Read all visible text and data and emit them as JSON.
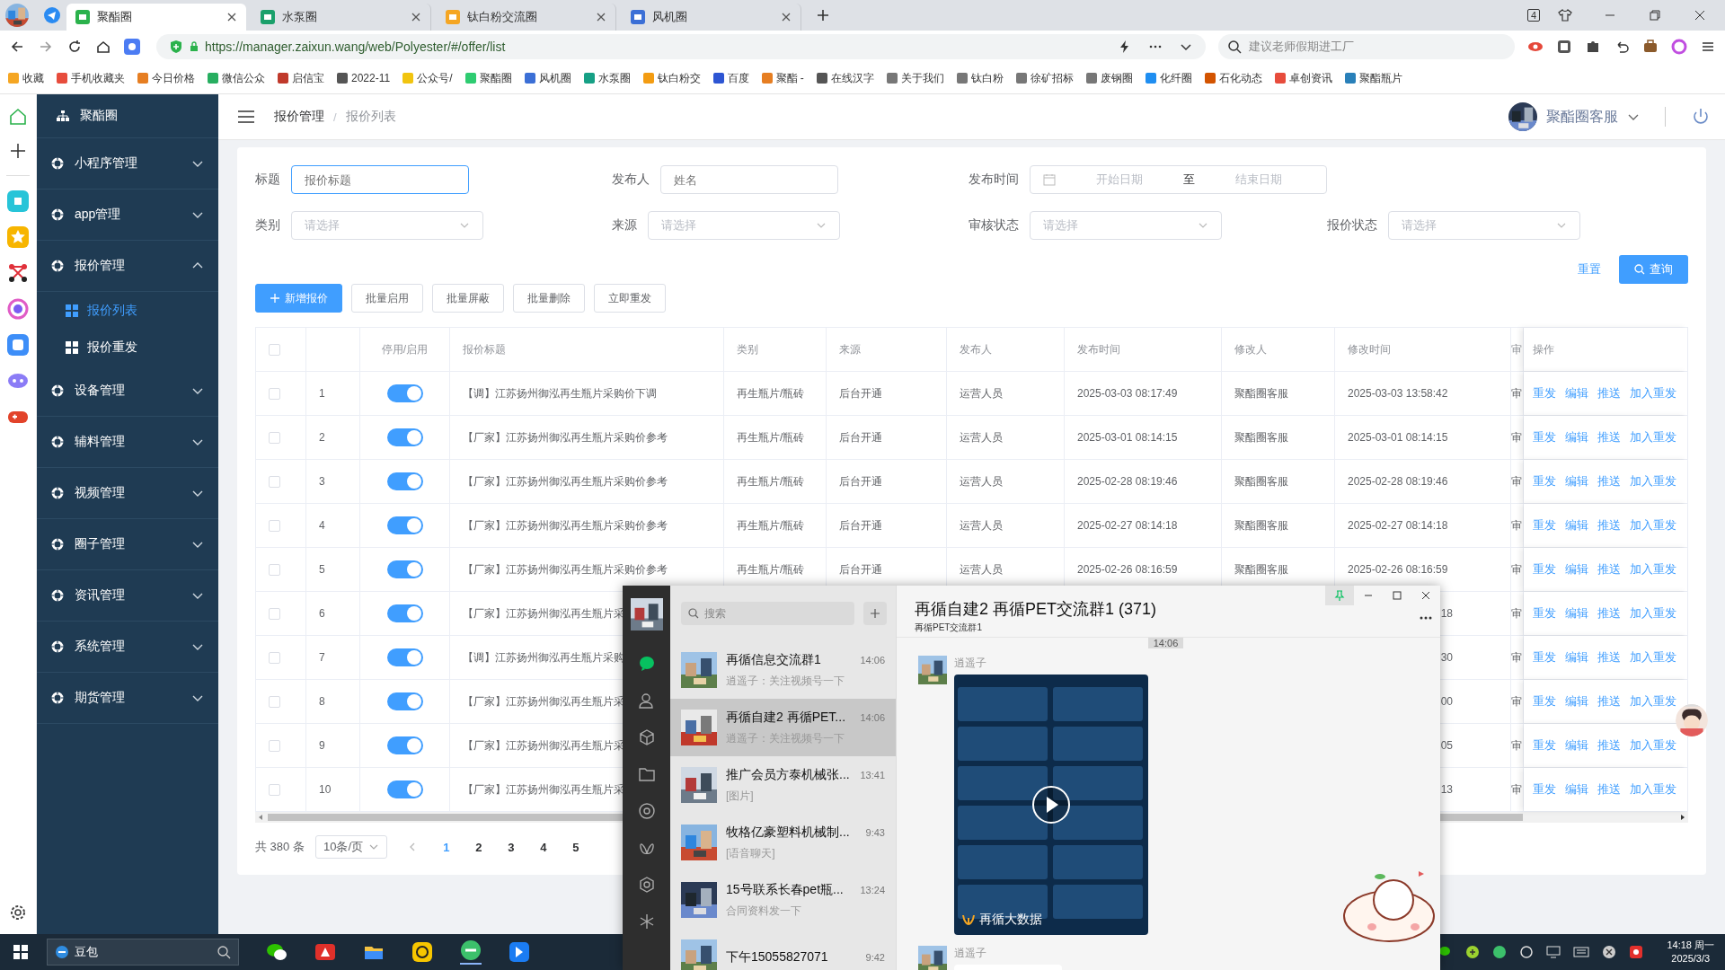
{
  "browser": {
    "tabs": [
      {
        "title": "聚酯圈",
        "selected": true
      },
      {
        "title": "水泵圈",
        "selected": false
      },
      {
        "title": "钛白粉交流圈",
        "selected": false
      },
      {
        "title": "风机圈",
        "selected": false
      }
    ],
    "window_count": "4",
    "url": "https://manager.zaixun.wang/web/Polyester/#/offer/list",
    "search": {
      "placeholder": "建议老师假期进工厂"
    },
    "bookmarks": [
      "收藏",
      "手机收藏夹",
      "今日价格",
      "微信公众",
      "启信宝",
      "2022-11",
      "公众号/",
      "聚酯圈",
      "风机圈",
      "水泵圈",
      "钛白粉交",
      "百度",
      "聚酯 -",
      "在线汉字",
      "关于我们",
      "钛白粉",
      "徐矿招标",
      "废钢圈",
      "化纤圈",
      "石化动态",
      "卓创资讯",
      "聚酯瓶片"
    ]
  },
  "sidebar": {
    "brand": "聚酯圈",
    "items": [
      {
        "label": "小程序管理",
        "expanded": false
      },
      {
        "label": "app管理",
        "expanded": false
      },
      {
        "label": "报价管理",
        "expanded": true,
        "children": [
          {
            "label": "报价列表",
            "selected": true
          },
          {
            "label": "报价重发",
            "selected": false
          }
        ]
      },
      {
        "label": "设备管理",
        "expanded": false
      },
      {
        "label": "辅料管理",
        "expanded": false
      },
      {
        "label": "视频管理",
        "expanded": false
      },
      {
        "label": "圈子管理",
        "expanded": false
      },
      {
        "label": "资讯管理",
        "expanded": false
      },
      {
        "label": "系统管理",
        "expanded": false
      },
      {
        "label": "期货管理",
        "expanded": false
      }
    ]
  },
  "header": {
    "breadcrumb": [
      "报价管理",
      "报价列表"
    ],
    "separator": "/",
    "user": "聚酯圈客服"
  },
  "filter_rows": [
    [
      {
        "label": "标题",
        "kind": "input",
        "placeholder": "报价标题",
        "focused": true
      },
      {
        "label": "发布人",
        "kind": "input",
        "placeholder": "姓名",
        "focused": false
      },
      {
        "label": "发布时间",
        "kind": "daterange",
        "start_placeholder": "开始日期",
        "separator": "至",
        "end_placeholder": "结束日期"
      }
    ],
    [
      {
        "label": "类别",
        "kind": "select",
        "placeholder": "请选择"
      },
      {
        "label": "来源",
        "kind": "select",
        "placeholder": "请选择"
      },
      {
        "label": "审核状态",
        "kind": "select",
        "placeholder": "请选择"
      },
      {
        "label": "报价状态",
        "kind": "select",
        "placeholder": "请选择"
      }
    ]
  ],
  "search_buttons": {
    "reset": "重置",
    "query": "查询"
  },
  "actions": [
    {
      "label": "新增报价",
      "kind": "primary"
    },
    {
      "label": "批量启用",
      "kind": "default"
    },
    {
      "label": "批量屏蔽",
      "kind": "default"
    },
    {
      "label": "批量删除",
      "kind": "default"
    },
    {
      "label": "立即重发",
      "kind": "default"
    }
  ],
  "table": {
    "all_checked": false,
    "columns": [
      "停用/启用",
      "报价标题",
      "类别",
      "来源",
      "发布人",
      "发布时间",
      "修改人",
      "修改时间",
      "审",
      "操作"
    ],
    "rows": [
      {
        "kind": "full",
        "checked": false,
        "index": "1",
        "enabled": true,
        "title": "【调】江苏扬州御泓再生瓶片采购价下调",
        "category": "再生瓶片/瓶砖",
        "source": "后台开通",
        "publisher": "运营人员",
        "published": "2025-03-03 08:17:49",
        "modifier": "聚酯圈客服",
        "modified": "2025-03-03 13:58:42",
        "column_9": "审",
        "ops": [
          "重发",
          "编辑",
          "推送",
          "加入重发"
        ]
      },
      {
        "kind": "full",
        "checked": false,
        "index": "2",
        "enabled": true,
        "title": "【厂家】江苏扬州御泓再生瓶片采购价参考",
        "category": "再生瓶片/瓶砖",
        "source": "后台开通",
        "publisher": "运营人员",
        "published": "2025-03-01 08:14:15",
        "modifier": "聚酯圈客服",
        "modified": "2025-03-01 08:14:15",
        "column_9": "审",
        "ops": [
          "重发",
          "编辑",
          "推送",
          "加入重发"
        ]
      },
      {
        "kind": "full",
        "checked": false,
        "index": "3",
        "enabled": true,
        "title": "【厂家】江苏扬州御泓再生瓶片采购价参考",
        "category": "再生瓶片/瓶砖",
        "source": "后台开通",
        "publisher": "运营人员",
        "published": "2025-02-28 08:19:46",
        "modifier": "聚酯圈客服",
        "modified": "2025-02-28 08:19:46",
        "column_9": "审",
        "ops": [
          "重发",
          "编辑",
          "推送",
          "加入重发"
        ]
      },
      {
        "kind": "full",
        "checked": false,
        "index": "4",
        "enabled": true,
        "title": "【厂家】江苏扬州御泓再生瓶片采购价参考",
        "category": "再生瓶片/瓶砖",
        "source": "后台开通",
        "publisher": "运营人员",
        "published": "2025-02-27 08:14:18",
        "modifier": "聚酯圈客服",
        "modified": "2025-02-27 08:14:18",
        "column_9": "审",
        "ops": [
          "重发",
          "编辑",
          "推送",
          "加入重发"
        ]
      },
      {
        "kind": "full",
        "checked": false,
        "index": "5",
        "enabled": true,
        "title": "【厂家】江苏扬州御泓再生瓶片采购价参考",
        "category": "再生瓶片/瓶砖",
        "source": "后台开通",
        "publisher": "运营人员",
        "published": "2025-02-26 08:16:59",
        "modifier": "聚酯圈客服",
        "modified": "2025-02-26 08:16:59",
        "column_9": "审",
        "ops": [
          "重发",
          "编辑",
          "推送",
          "加入重发"
        ]
      },
      {
        "kind": "partial",
        "checked": false,
        "index": "6",
        "enabled": true,
        "title": "【厂家】江苏扬州御泓再生瓶片采",
        "modified": "18",
        "column_9": "审",
        "ops": [
          "重发",
          "编辑",
          "推送",
          "加入重发"
        ]
      },
      {
        "kind": "partial",
        "checked": false,
        "index": "7",
        "enabled": true,
        "title": "【调】江苏扬州御泓再生瓶片采购",
        "modified": "30",
        "column_9": "审",
        "ops": [
          "重发",
          "编辑",
          "推送",
          "加入重发"
        ]
      },
      {
        "kind": "partial",
        "checked": false,
        "index": "8",
        "enabled": true,
        "title": "【厂家】江苏扬州御泓再生瓶片采",
        "modified": "00",
        "column_9": "审",
        "ops": [
          "重发",
          "编辑",
          "推送",
          "加入重发"
        ]
      },
      {
        "kind": "partial",
        "checked": false,
        "index": "9",
        "enabled": true,
        "title": "【厂家】江苏扬州御泓再生瓶片采",
        "modified": "05",
        "column_9": "审",
        "ops": [
          "重发",
          "编辑",
          "推送",
          "加入重发"
        ]
      },
      {
        "kind": "partial",
        "checked": false,
        "index": "10",
        "enabled": true,
        "title": "【厂家】江苏扬州御泓再生瓶片采",
        "modified": "13",
        "column_9": "审",
        "ops": [
          "重发",
          "编辑",
          "推送",
          "加入重发"
        ]
      }
    ]
  },
  "pagination": {
    "total": "共 380 条",
    "page_size": "10条/页",
    "pages": [
      {
        "label": "1",
        "selected": true
      },
      {
        "label": "2",
        "selected": false
      },
      {
        "label": "3",
        "selected": false
      },
      {
        "label": "4",
        "selected": false
      },
      {
        "label": "5",
        "selected": false
      }
    ]
  },
  "chat": {
    "search_placeholder": "搜索",
    "conversations": [
      {
        "name": "再循信息交流群1",
        "time": "14:06",
        "preview": "逍遥子：关注视频号一下",
        "selected": false
      },
      {
        "name": "再循自建2 再循PET...",
        "time": "14:06",
        "preview": "逍遥子：关注视频号一下",
        "selected": true
      },
      {
        "name": "推广会员方泰机械张...",
        "time": "13:41",
        "preview": "[图片]",
        "selected": false
      },
      {
        "name": "牧格亿豪塑料机械制...",
        "time": "9:43",
        "preview": "[语音聊天]",
        "selected": false
      },
      {
        "name": "15号联系长春pet瓶...",
        "time": "13:24",
        "preview": "合同资料发一下",
        "selected": false
      },
      {
        "name": "下午15055827071",
        "time": "9:42",
        "selected": false
      }
    ],
    "title": "再循自建2 再循PET交流群1 (371)",
    "subtitle": "再循PET交流群1",
    "pinned": true,
    "timestamp": "14:06",
    "messages": [
      {
        "sender": "逍遥子",
        "kind": "video",
        "caption": "再循大数据"
      },
      {
        "sender": "逍遥子",
        "kind": "cut"
      }
    ]
  },
  "taskbar": {
    "search": "豆包",
    "time": "14:18 周一",
    "date": "2025/3/3"
  }
}
